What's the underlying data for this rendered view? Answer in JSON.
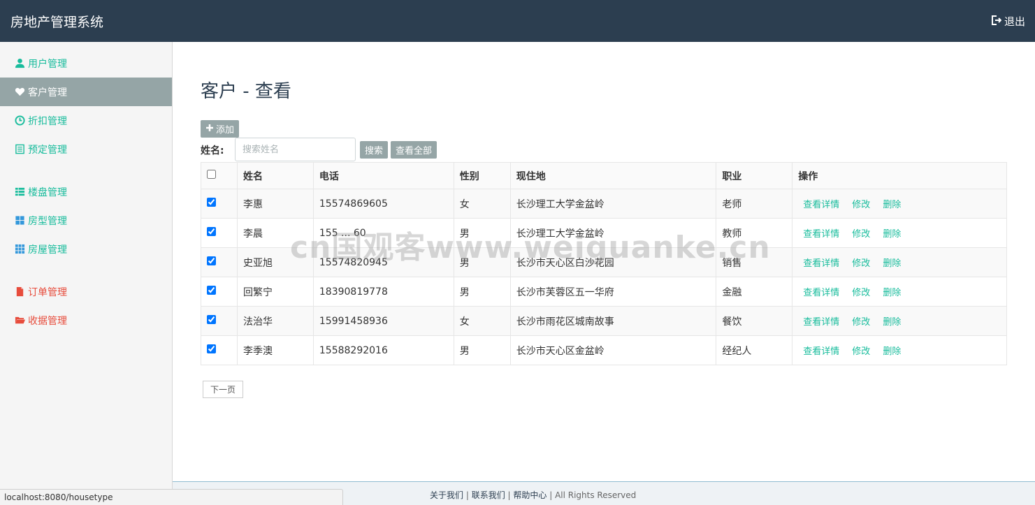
{
  "app": {
    "title": "房地产管理系统",
    "logout_label": "退出"
  },
  "sidebar": {
    "items": [
      {
        "label": "用户管理",
        "icon": "user-icon"
      },
      {
        "label": "客户管理",
        "icon": "heart-icon"
      },
      {
        "label": "折扣管理",
        "icon": "clock-icon"
      },
      {
        "label": "预定管理",
        "icon": "list-icon"
      },
      {
        "label": "楼盘管理",
        "icon": "th-list-icon"
      },
      {
        "label": "房型管理",
        "icon": "th-large-icon"
      },
      {
        "label": "房屋管理",
        "icon": "th-icon"
      },
      {
        "label": "订单管理",
        "icon": "file-icon"
      },
      {
        "label": "收据管理",
        "icon": "folder-open-icon"
      }
    ]
  },
  "main": {
    "title": "客户 - 查看",
    "add_label": "添加",
    "search_label": "姓名:",
    "search_placeholder": "搜索姓名",
    "search_button": "搜索",
    "view_all_button": "查看全部",
    "next_page": "下一页"
  },
  "table": {
    "headers": [
      "姓名",
      "电话",
      "性别",
      "现住地",
      "职业",
      "操作"
    ],
    "rows": [
      {
        "name": "李惠",
        "phone": "15574869605",
        "gender": "女",
        "address": "长沙理工大学金盆岭",
        "job": "老师"
      },
      {
        "name": "李晨",
        "phone": "155 ... 60",
        "gender": "男",
        "address": "长沙理工大学金盆岭",
        "job": "教师"
      },
      {
        "name": "史亚旭",
        "phone": "15574820945",
        "gender": "男",
        "address": "长沙市天心区白沙花园",
        "job": "销售"
      },
      {
        "name": "回繁宁",
        "phone": "18390819778",
        "gender": "男",
        "address": "长沙市芙蓉区五一华府",
        "job": "金融"
      },
      {
        "name": "法治华",
        "phone": "15991458936",
        "gender": "女",
        "address": "长沙市雨花区城南故事",
        "job": "餐饮"
      },
      {
        "name": "李季澳",
        "phone": "15588292016",
        "gender": "男",
        "address": "长沙市天心区金盆岭",
        "job": "经纪人"
      }
    ],
    "actions": {
      "detail": "查看详情",
      "edit": "修改",
      "delete": "删除"
    }
  },
  "footer": {
    "about": "关于我们",
    "contact": "联系我们",
    "help": "帮助中心",
    "rights": "All Rights Reserved"
  },
  "statusbar": {
    "url": "localhost:8080/housetype"
  },
  "watermark": "cn国观客www.weiguanke.cn",
  "colors": {
    "navbar": "#2c3e50",
    "accent": "#18bc9c",
    "danger": "#e74c3c",
    "active": "#95a5a6"
  }
}
